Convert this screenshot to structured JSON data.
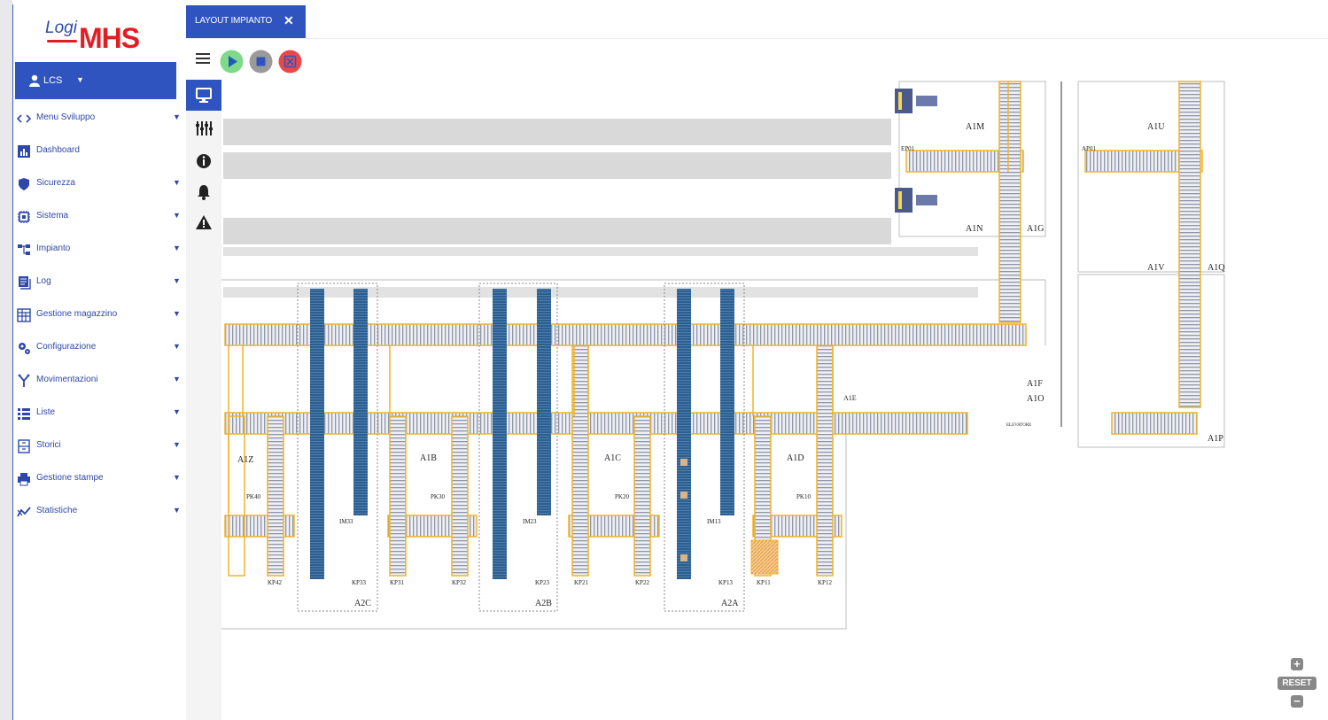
{
  "brand": {
    "logo_top": "Logi",
    "logo_main": "MHS",
    "primary_color": "#2f54c0",
    "logo_red": "#e21e25"
  },
  "user": {
    "name": "LCS",
    "icon": "user-icon"
  },
  "menu": [
    {
      "label": "Menu Sviluppo",
      "icon": "code-icon",
      "has_caret": true
    },
    {
      "label": "Dashboard",
      "icon": "chart-icon",
      "has_caret": false
    },
    {
      "label": "Sicurezza",
      "icon": "shield-icon",
      "has_caret": true
    },
    {
      "label": "Sistema",
      "icon": "cpu-icon",
      "has_caret": true
    },
    {
      "label": "Impianto",
      "icon": "sitemap-icon",
      "has_caret": true
    },
    {
      "label": "Log",
      "icon": "log-icon",
      "has_caret": true
    },
    {
      "label": "Gestione magazzino",
      "icon": "warehouse-icon",
      "has_caret": true
    },
    {
      "label": "Configurazione",
      "icon": "cogs-icon",
      "has_caret": true
    },
    {
      "label": "Movimentazioni",
      "icon": "fork-icon",
      "has_caret": true
    },
    {
      "label": "Liste",
      "icon": "list-icon",
      "has_caret": true
    },
    {
      "label": "Storici",
      "icon": "archive-icon",
      "has_caret": true
    },
    {
      "label": "Gestione stampe",
      "icon": "print-icon",
      "has_caret": true
    },
    {
      "label": "Statistiche",
      "icon": "stats-icon",
      "has_caret": true
    }
  ],
  "tab": {
    "label": "LAYOUT IMPIANTO",
    "close": "✕"
  },
  "toolbar": {
    "play": "play-icon",
    "stop": "stop-icon",
    "abort": "abort-icon"
  },
  "side_tools": [
    "monitor-icon",
    "sliders-icon",
    "info-icon",
    "bell-icon",
    "warning-icon"
  ],
  "zoom": {
    "plus": "+",
    "reset": "RESET",
    "minus": "−"
  },
  "layout": {
    "areas": [
      "A1Z",
      "A1B",
      "A1C",
      "A1D",
      "A2C",
      "A2B",
      "A2A",
      "A1M",
      "A1N",
      "A1G",
      "A1U",
      "A1V",
      "A1Q",
      "A1F",
      "A1O",
      "A1E",
      "A1P"
    ],
    "stations": [
      "PK40",
      "PK30",
      "PK20",
      "PK10"
    ],
    "ports": [
      "KP42",
      "KP33",
      "KP31",
      "KP32",
      "KP23",
      "KP21",
      "KP22",
      "KP13",
      "KP11",
      "KP12"
    ],
    "misc": [
      "IM33",
      "IM23",
      "IM13",
      "EP01",
      "AP01",
      "ELEVATORE"
    ]
  }
}
